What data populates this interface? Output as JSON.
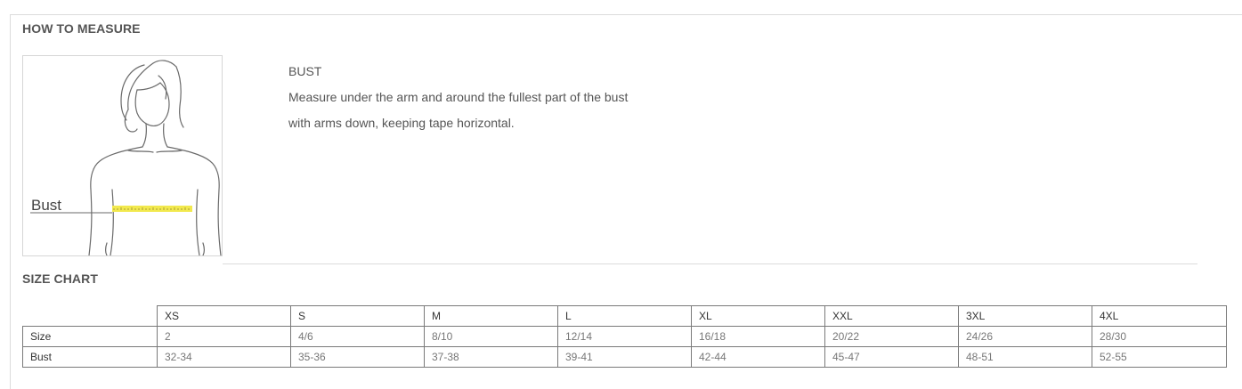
{
  "how_to_measure": {
    "title": "HOW TO MEASURE",
    "figure_label": "Bust",
    "measurement": {
      "heading": "BUST",
      "lines": [
        "Measure under the arm and around the fullest part of the bust",
        "with arms down, keeping tape horizontal."
      ]
    }
  },
  "size_chart": {
    "title": "SIZE CHART",
    "columns": [
      "XS",
      "S",
      "M",
      "L",
      "XL",
      "XXL",
      "3XL",
      "4XL"
    ],
    "rows": [
      {
        "label": "Size",
        "values": [
          "2",
          "4/6",
          "8/10",
          "12/14",
          "16/18",
          "20/22",
          "24/26",
          "28/30"
        ]
      },
      {
        "label": "Bust",
        "values": [
          "32-34",
          "35-36",
          "37-38",
          "39-41",
          "42-44",
          "45-47",
          "48-51",
          "52-55"
        ]
      }
    ]
  },
  "colors": {
    "tape": "#f2e94e",
    "rule": "#dcdcdc",
    "table_border": "#7a7a7a"
  }
}
